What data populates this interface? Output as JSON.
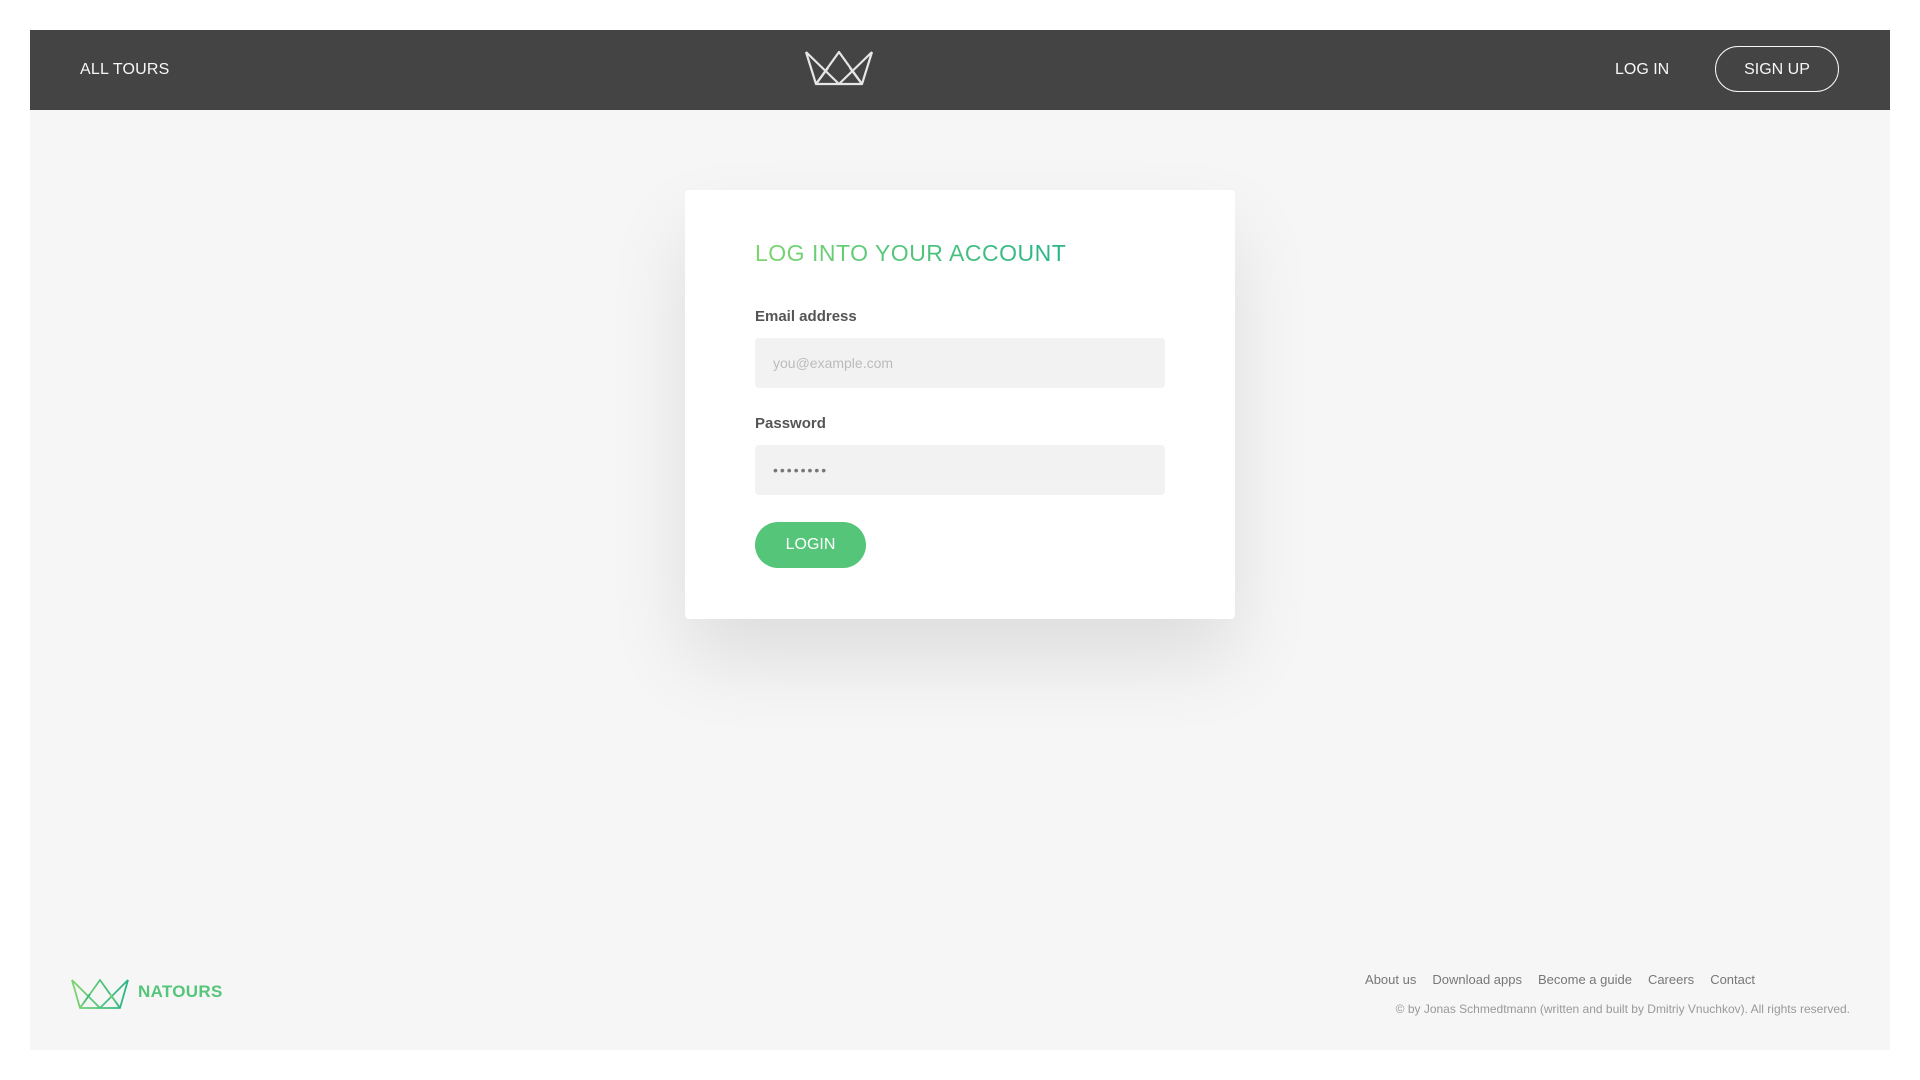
{
  "header": {
    "all_tours_label": "ALL TOURS",
    "login_label": "LOG IN",
    "signup_label": "SIGN UP",
    "logo_icon": "natours-crown-logo-icon"
  },
  "login_form": {
    "title": "LOG INTO YOUR ACCOUNT",
    "email_label": "Email address",
    "email_placeholder": "you@example.com",
    "email_value": "",
    "password_label": "Password",
    "password_value": "••••••••",
    "submit_label": "LOGIN"
  },
  "footer": {
    "brand": "NATOURS",
    "links": [
      "About us",
      "Download apps",
      "Become a guide",
      "Careers",
      "Contact"
    ],
    "copyright": "© by Jonas Schmedtmann (written and built by Dmitriy Vnuchkov). All rights reserved."
  },
  "colors": {
    "header_bg": "#444444",
    "accent_green": "#55c57a",
    "accent_green_dark": "#28b487",
    "page_bg": "#f6f6f6",
    "card_bg": "#ffffff",
    "input_bg": "#f2f2f2"
  }
}
